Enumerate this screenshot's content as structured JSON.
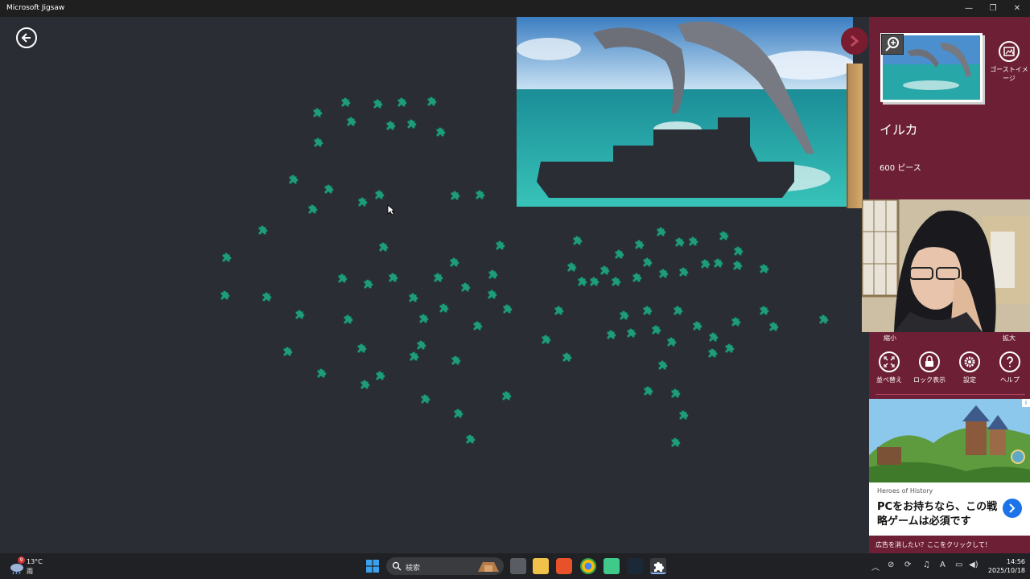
{
  "window": {
    "title": "Microsoft Jigsaw",
    "minimize_glyph": "—",
    "maximize_glyph": "❐",
    "close_glyph": "✕"
  },
  "puzzle": {
    "title": "イルカ",
    "piece_count_label": "600 ピース",
    "ghost_image_label": "ゴーストイメージ"
  },
  "zoom": {
    "out_label": "縮小",
    "in_label": "拡大"
  },
  "tools": [
    {
      "label": "並べ替え",
      "icon": "shuffle-icon"
    },
    {
      "label": "ロック表示",
      "icon": "lock-icon"
    },
    {
      "label": "設定",
      "icon": "gear-icon"
    },
    {
      "label": "ヘルプ",
      "icon": "help-icon"
    }
  ],
  "ad": {
    "brand": "Heroes of History",
    "headline": "PCをお持ちなら、この戦略ゲームは必須です",
    "remove_label": "広告を消したい？ここをクリックして！",
    "info_glyph": "i"
  },
  "taskbar": {
    "weather_temp": "13°C",
    "weather_cond": "雨",
    "weather_badge": "9",
    "search_label": "検索",
    "time": "14:56",
    "date": "2025/10/18",
    "ime_label": "A"
  },
  "colors": {
    "panel": "#6d1f35",
    "workspace": "#2b2d35",
    "piece": "#1f9c7a"
  }
}
